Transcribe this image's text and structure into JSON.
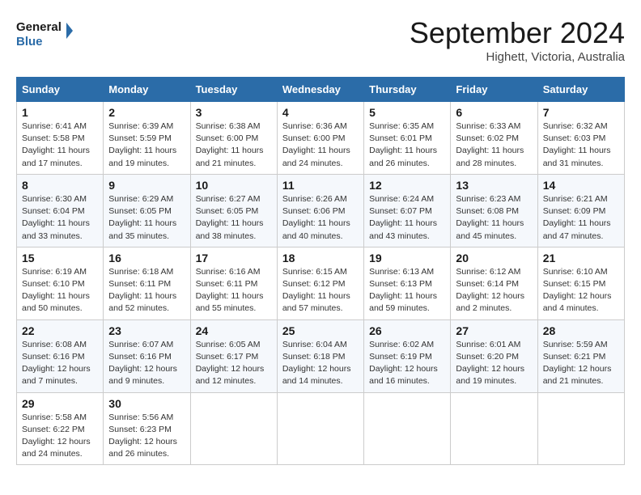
{
  "header": {
    "logo_line1": "General",
    "logo_line2": "Blue",
    "month": "September 2024",
    "location": "Highett, Victoria, Australia"
  },
  "weekdays": [
    "Sunday",
    "Monday",
    "Tuesday",
    "Wednesday",
    "Thursday",
    "Friday",
    "Saturday"
  ],
  "weeks": [
    [
      {
        "day": "1",
        "sunrise": "6:41 AM",
        "sunset": "5:58 PM",
        "daylight": "11 hours and 17 minutes."
      },
      {
        "day": "2",
        "sunrise": "6:39 AM",
        "sunset": "5:59 PM",
        "daylight": "11 hours and 19 minutes."
      },
      {
        "day": "3",
        "sunrise": "6:38 AM",
        "sunset": "6:00 PM",
        "daylight": "11 hours and 21 minutes."
      },
      {
        "day": "4",
        "sunrise": "6:36 AM",
        "sunset": "6:00 PM",
        "daylight": "11 hours and 24 minutes."
      },
      {
        "day": "5",
        "sunrise": "6:35 AM",
        "sunset": "6:01 PM",
        "daylight": "11 hours and 26 minutes."
      },
      {
        "day": "6",
        "sunrise": "6:33 AM",
        "sunset": "6:02 PM",
        "daylight": "11 hours and 28 minutes."
      },
      {
        "day": "7",
        "sunrise": "6:32 AM",
        "sunset": "6:03 PM",
        "daylight": "11 hours and 31 minutes."
      }
    ],
    [
      {
        "day": "8",
        "sunrise": "6:30 AM",
        "sunset": "6:04 PM",
        "daylight": "11 hours and 33 minutes."
      },
      {
        "day": "9",
        "sunrise": "6:29 AM",
        "sunset": "6:05 PM",
        "daylight": "11 hours and 35 minutes."
      },
      {
        "day": "10",
        "sunrise": "6:27 AM",
        "sunset": "6:05 PM",
        "daylight": "11 hours and 38 minutes."
      },
      {
        "day": "11",
        "sunrise": "6:26 AM",
        "sunset": "6:06 PM",
        "daylight": "11 hours and 40 minutes."
      },
      {
        "day": "12",
        "sunrise": "6:24 AM",
        "sunset": "6:07 PM",
        "daylight": "11 hours and 43 minutes."
      },
      {
        "day": "13",
        "sunrise": "6:23 AM",
        "sunset": "6:08 PM",
        "daylight": "11 hours and 45 minutes."
      },
      {
        "day": "14",
        "sunrise": "6:21 AM",
        "sunset": "6:09 PM",
        "daylight": "11 hours and 47 minutes."
      }
    ],
    [
      {
        "day": "15",
        "sunrise": "6:19 AM",
        "sunset": "6:10 PM",
        "daylight": "11 hours and 50 minutes."
      },
      {
        "day": "16",
        "sunrise": "6:18 AM",
        "sunset": "6:11 PM",
        "daylight": "11 hours and 52 minutes."
      },
      {
        "day": "17",
        "sunrise": "6:16 AM",
        "sunset": "6:11 PM",
        "daylight": "11 hours and 55 minutes."
      },
      {
        "day": "18",
        "sunrise": "6:15 AM",
        "sunset": "6:12 PM",
        "daylight": "11 hours and 57 minutes."
      },
      {
        "day": "19",
        "sunrise": "6:13 AM",
        "sunset": "6:13 PM",
        "daylight": "11 hours and 59 minutes."
      },
      {
        "day": "20",
        "sunrise": "6:12 AM",
        "sunset": "6:14 PM",
        "daylight": "12 hours and 2 minutes."
      },
      {
        "day": "21",
        "sunrise": "6:10 AM",
        "sunset": "6:15 PM",
        "daylight": "12 hours and 4 minutes."
      }
    ],
    [
      {
        "day": "22",
        "sunrise": "6:08 AM",
        "sunset": "6:16 PM",
        "daylight": "12 hours and 7 minutes."
      },
      {
        "day": "23",
        "sunrise": "6:07 AM",
        "sunset": "6:16 PM",
        "daylight": "12 hours and 9 minutes."
      },
      {
        "day": "24",
        "sunrise": "6:05 AM",
        "sunset": "6:17 PM",
        "daylight": "12 hours and 12 minutes."
      },
      {
        "day": "25",
        "sunrise": "6:04 AM",
        "sunset": "6:18 PM",
        "daylight": "12 hours and 14 minutes."
      },
      {
        "day": "26",
        "sunrise": "6:02 AM",
        "sunset": "6:19 PM",
        "daylight": "12 hours and 16 minutes."
      },
      {
        "day": "27",
        "sunrise": "6:01 AM",
        "sunset": "6:20 PM",
        "daylight": "12 hours and 19 minutes."
      },
      {
        "day": "28",
        "sunrise": "5:59 AM",
        "sunset": "6:21 PM",
        "daylight": "12 hours and 21 minutes."
      }
    ],
    [
      {
        "day": "29",
        "sunrise": "5:58 AM",
        "sunset": "6:22 PM",
        "daylight": "12 hours and 24 minutes."
      },
      {
        "day": "30",
        "sunrise": "5:56 AM",
        "sunset": "6:23 PM",
        "daylight": "12 hours and 26 minutes."
      },
      null,
      null,
      null,
      null,
      null
    ]
  ]
}
